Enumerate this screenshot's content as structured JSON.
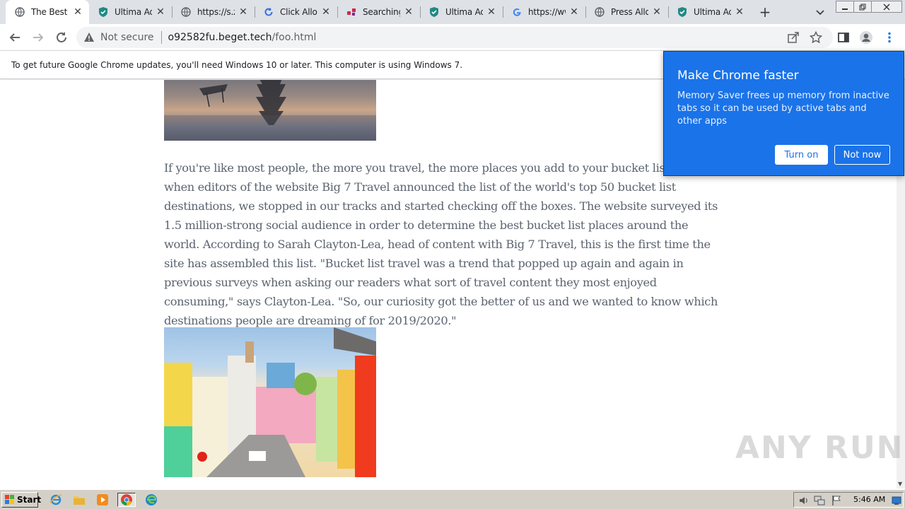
{
  "tabs": [
    {
      "title": "The Best Pl",
      "favicon": "globe-icon",
      "active": true
    },
    {
      "title": "Ultima AdBl",
      "favicon": "shield-icon",
      "active": false
    },
    {
      "title": "https://s.zi",
      "favicon": "globe-icon",
      "active": false
    },
    {
      "title": "Click Allow",
      "favicon": "refresh-icon",
      "active": false
    },
    {
      "title": "Searching f",
      "favicon": "dots-icon",
      "active": false
    },
    {
      "title": "Ultima AdBl",
      "favicon": "shield-icon",
      "active": false
    },
    {
      "title": "https://ww",
      "favicon": "google-icon",
      "active": false
    },
    {
      "title": "Press Allow",
      "favicon": "globe-icon",
      "active": false
    },
    {
      "title": "Ultima AdBl",
      "favicon": "shield-icon",
      "active": false
    }
  ],
  "omnibox": {
    "security_label": "Not secure",
    "host": "o92582fu.beget.tech",
    "path": "/foo.html"
  },
  "infobar": {
    "message": "To get future Google Chrome updates, you'll need Windows 10 or later. This computer is using Windows 7."
  },
  "article": {
    "paragraph": "If you're like most people, the more you travel, the more places you add to your bucket list. So when editors of the website Big 7 Travel announced the list of the world's top 50 bucket list destinations, we stopped in our tracks and started checking off the boxes. The website surveyed its 1.5 million-strong social audience in order to determine the best bucket list places around the world. According to Sarah Clayton-Lea, head of content with Big 7 Travel, this is the first time the site has assembled this list. \"Bucket list travel was a trend that popped up again and again in previous surveys when asking our readers what sort of travel content they most enjoyed consuming,\" says Clayton-Lea. \"So, our curiosity got the better of us and we wanted to know which destinations people are dreaming of for 2019/2020.\""
  },
  "popup": {
    "title": "Make Chrome faster",
    "body": "Memory Saver frees up memory from inactive tabs so it can be used by active tabs and other apps",
    "turn_on_label": "Turn on",
    "not_now_label": "Not now"
  },
  "watermark": "ANY RUN",
  "taskbar": {
    "start_label": "Start",
    "clock": "5:46 AM"
  },
  "colors": {
    "popup_bg": "#1a73e8",
    "tab_strip": "#dee1e6",
    "taskbar": "#d4d0c8"
  }
}
